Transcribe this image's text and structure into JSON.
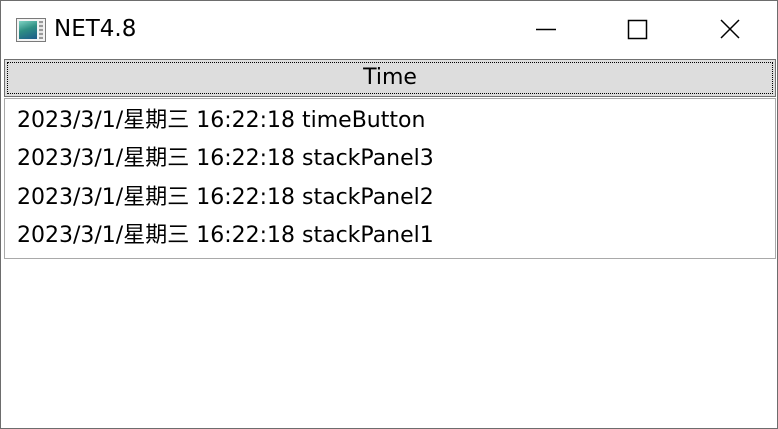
{
  "window": {
    "title": "NET4.8",
    "icon": "app-window-icon",
    "controls": {
      "minimize_icon": "minimize-icon",
      "maximize_icon": "maximize-icon",
      "close_icon": "close-icon"
    }
  },
  "main": {
    "time_button_label": "Time",
    "log_items": [
      "2023/3/1/星期三 16:22:18 timeButton",
      "2023/3/1/星期三 16:22:18 stackPanel3",
      "2023/3/1/星期三 16:22:18 stackPanel2",
      "2023/3/1/星期三 16:22:18 stackPanel1"
    ]
  },
  "colors": {
    "button_face": "#dddddd",
    "button_border": "#707070",
    "list_border": "#a9a9a9",
    "window_background": "#ffffff"
  }
}
